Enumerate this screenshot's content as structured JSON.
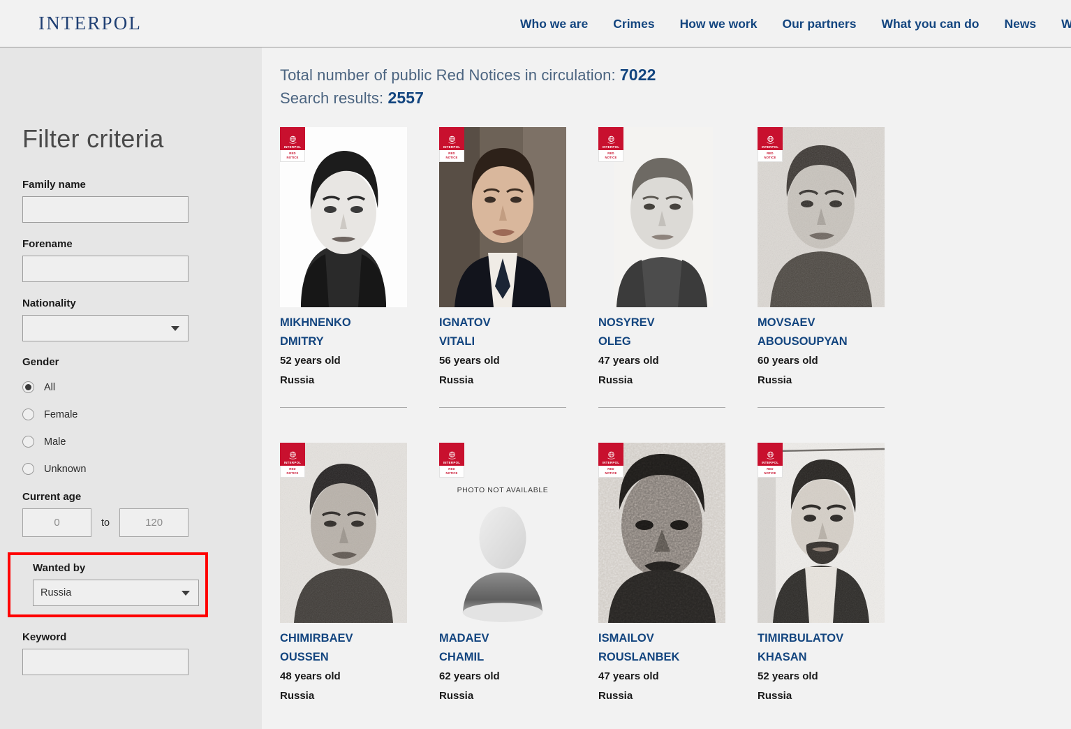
{
  "header": {
    "logo": "INTERPOL",
    "nav": [
      {
        "label": "Who we are"
      },
      {
        "label": "Crimes"
      },
      {
        "label": "How we work"
      },
      {
        "label": "Our partners"
      },
      {
        "label": "What you can do"
      },
      {
        "label": "News"
      },
      {
        "label": "Want"
      }
    ]
  },
  "sidebar": {
    "title": "Filter criteria",
    "family_name": {
      "label": "Family name",
      "value": "",
      "placeholder": ""
    },
    "forename": {
      "label": "Forename",
      "value": "",
      "placeholder": ""
    },
    "nationality": {
      "label": "Nationality",
      "value": ""
    },
    "gender": {
      "label": "Gender",
      "options": [
        {
          "label": "All",
          "selected": true
        },
        {
          "label": "Female",
          "selected": false
        },
        {
          "label": "Male",
          "selected": false
        },
        {
          "label": "Unknown",
          "selected": false
        }
      ]
    },
    "current_age": {
      "label": "Current age",
      "from_placeholder": "0",
      "from_value": "",
      "separator": "to",
      "to_placeholder": "120",
      "to_value": ""
    },
    "wanted_by": {
      "label": "Wanted by",
      "value": "Russia",
      "highlight_color": "#ff0000"
    },
    "keyword": {
      "label": "Keyword",
      "value": "",
      "placeholder": ""
    }
  },
  "results": {
    "total_label": "Total number of public Red Notices in circulation:",
    "total_count": "7022",
    "search_label": "Search results:",
    "search_count": "2557",
    "badge": {
      "word": "INTERPOL",
      "line1": "RED",
      "line2": "NOTICE"
    },
    "no_photo_text": "PHOTO NOT AVAILABLE",
    "cards": [
      {
        "family_name": "MIKHNENKO",
        "forename": "DMITRY",
        "age": "52 years old",
        "country": "Russia",
        "photo": "portrait-young-man-dark-hair"
      },
      {
        "family_name": "IGNATOV",
        "forename": "VITALI",
        "age": "56 years old",
        "country": "Russia",
        "photo": "portrait-man-suit-tie"
      },
      {
        "family_name": "NOSYREV",
        "forename": "OLEG",
        "age": "47 years old",
        "country": "Russia",
        "photo": "portrait-man-short-hair"
      },
      {
        "family_name": "MOVSAEV",
        "forename": "ABOUSOUPYAN",
        "age": "60 years old",
        "country": "Russia",
        "photo": "portrait-grainy-man"
      },
      {
        "family_name": "CHIMIRBAEV",
        "forename": "OUSSEN",
        "age": "48 years old",
        "country": "Russia",
        "photo": "portrait-man-grainy-face"
      },
      {
        "family_name": "MADAEV",
        "forename": "CHAMIL",
        "age": "62 years old",
        "country": "Russia",
        "photo": "no-photo"
      },
      {
        "family_name": "ISMAILOV",
        "forename": "ROUSLANBEK",
        "age": "47 years old",
        "country": "Russia",
        "photo": "portrait-very-grainy"
      },
      {
        "family_name": "TIMIRBULATOV",
        "forename": "KHASAN",
        "age": "52 years old",
        "country": "Russia",
        "photo": "portrait-bearded-man"
      }
    ]
  }
}
